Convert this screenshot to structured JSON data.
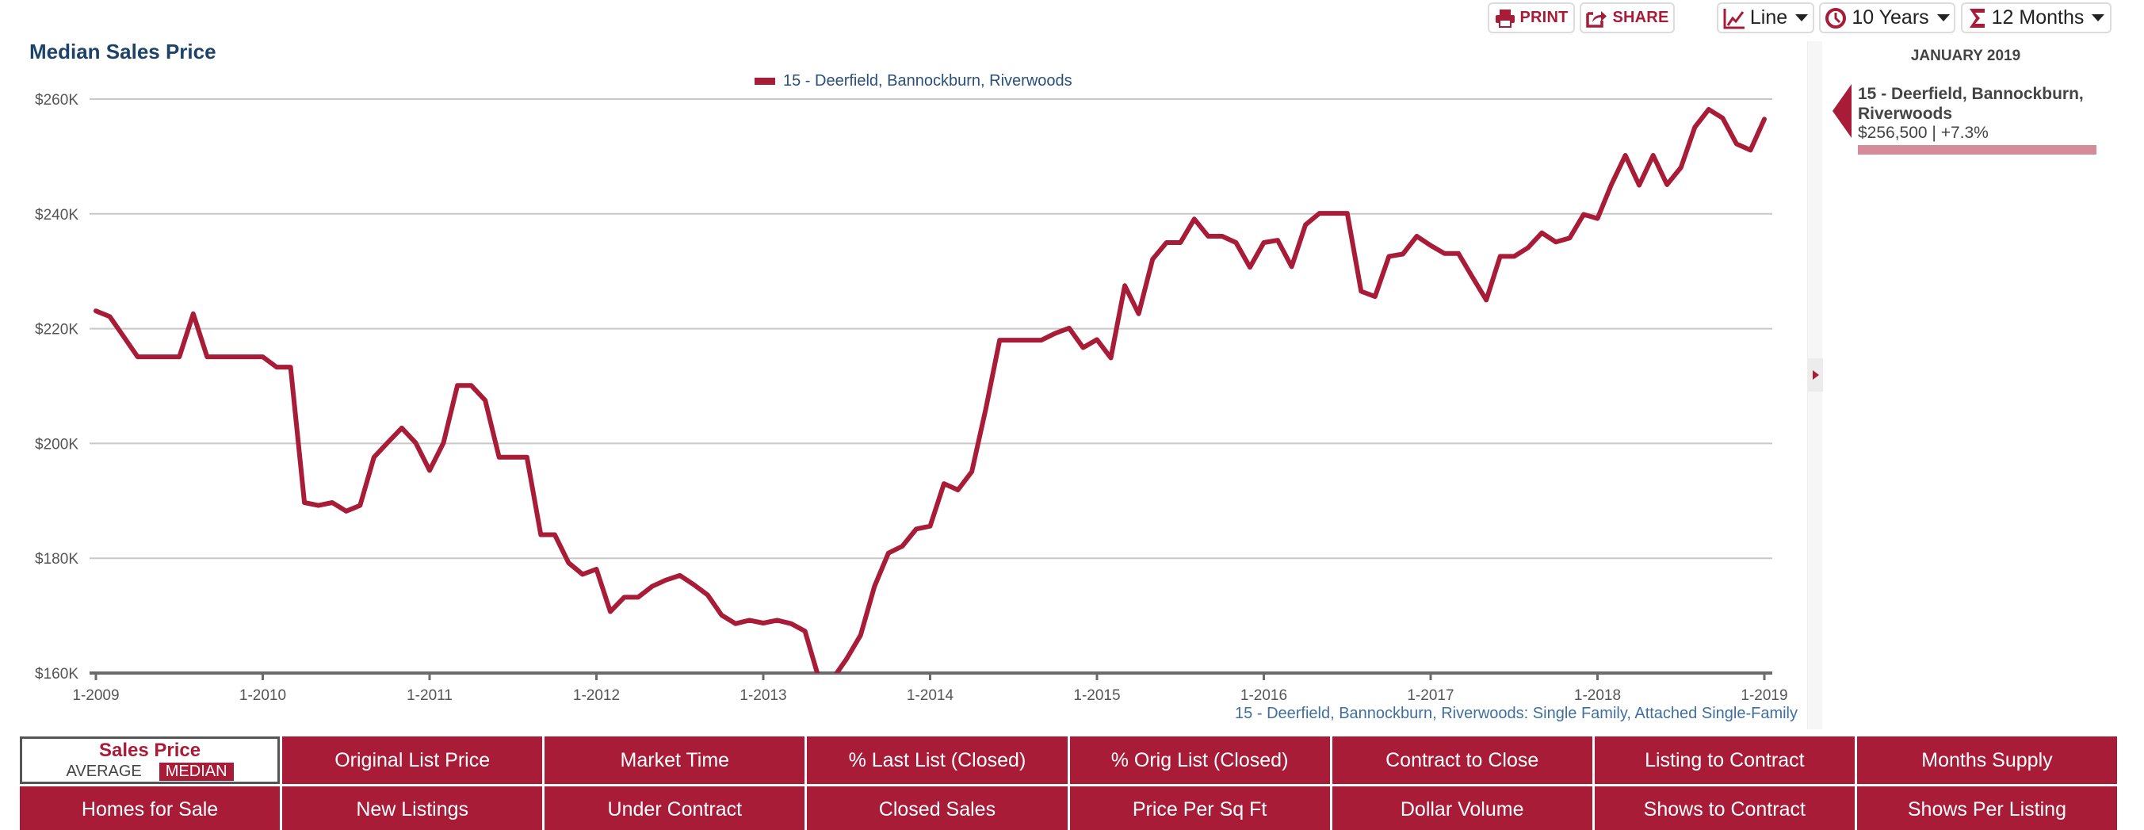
{
  "toolbar": {
    "print_label": "PRINT",
    "share_label": "SHARE",
    "chart_type": "Line",
    "period": "10 Years",
    "rolling": "12 Months",
    "icons": {
      "print": "printer-icon",
      "share": "share-icon",
      "chart_type": "line-chart-icon",
      "period": "clock-icon",
      "rolling": "sigma-icon"
    }
  },
  "colors": {
    "accent": "#a81c38",
    "title": "#1d4369",
    "legend_text": "#2a4f7a",
    "caption": "#3f6f9f",
    "grid": "#c8c8c8",
    "tooltip_bar": "#d58b99"
  },
  "chart_data": {
    "type": "line",
    "title": "Median Sales Price",
    "xlabel": "",
    "ylabel": "",
    "caption": "15 - Deerfield, Bannockburn, Riverwoods: Single Family, Attached Single-Family",
    "ylim": [
      160000,
      260000
    ],
    "y_ticks": [
      160000,
      180000,
      200000,
      220000,
      240000,
      260000
    ],
    "y_tick_labels": [
      "$160K",
      "$180K",
      "$200K",
      "$220K",
      "$240K",
      "$260K"
    ],
    "x_start": "2009-01",
    "x_end": "2019-01",
    "x_tick_labels": [
      "1-2009",
      "1-2010",
      "1-2011",
      "1-2012",
      "1-2013",
      "1-2014",
      "1-2015",
      "1-2016",
      "1-2017",
      "1-2018",
      "1-2019"
    ],
    "grid": true,
    "legend_position": "top-center",
    "series": [
      {
        "name": "15 - Deerfield, Bannockburn, Riverwoods",
        "color": "#a81c38",
        "frequency": "monthly",
        "values": [
          223100,
          222100,
          218600,
          215100,
          215100,
          215100,
          215100,
          222600,
          215100,
          215100,
          215100,
          215100,
          215100,
          213300,
          213300,
          189700,
          189200,
          189700,
          188200,
          189200,
          197600,
          200200,
          202700,
          200100,
          195300,
          200100,
          210100,
          210100,
          207500,
          197600,
          197600,
          197600,
          184100,
          184100,
          179200,
          177200,
          178100,
          170700,
          173200,
          173200,
          175100,
          176200,
          177000,
          175400,
          173600,
          170100,
          168600,
          169200,
          168700,
          169200,
          168600,
          167300,
          159000,
          159000,
          162500,
          166600,
          175100,
          180900,
          182100,
          185100,
          185600,
          193000,
          191900,
          195100,
          206000,
          218000,
          218000,
          218000,
          218000,
          219200,
          220100,
          216700,
          218100,
          214900,
          227500,
          222600,
          232100,
          235000,
          235000,
          239100,
          236100,
          236100,
          235000,
          230700,
          235000,
          235400,
          230800,
          238100,
          240100,
          240100,
          240100,
          226500,
          225600,
          232600,
          233000,
          236100,
          234500,
          233100,
          233100,
          229000,
          225000,
          232600,
          232600,
          234100,
          236700,
          235100,
          235800,
          239900,
          239200,
          245100,
          250200,
          245000,
          250200,
          245100,
          248100,
          255100,
          258200,
          256700,
          252200,
          251100,
          256500
        ]
      }
    ]
  },
  "side_panel": {
    "date": "JANUARY 2019",
    "entry_name": "15 - Deerfield, Bannockburn, Riverwoods",
    "entry_value": "$256,500 | +7.3%",
    "collapse_icon": "triangle-right-icon"
  },
  "tabs": {
    "active": {
      "title": "Sales Price",
      "options": [
        "AVERAGE",
        "MEDIAN"
      ],
      "selected_option": "MEDIAN"
    },
    "items": [
      "Original List Price",
      "Market Time",
      "% Last List (Closed)",
      "% Orig List (Closed)",
      "Contract to Close",
      "Listing to Contract",
      "Months Supply",
      "Homes for Sale",
      "New Listings",
      "Under Contract",
      "Closed Sales",
      "Price Per Sq Ft",
      "Dollar Volume",
      "Shows to Contract",
      "Shows Per Listing"
    ]
  }
}
